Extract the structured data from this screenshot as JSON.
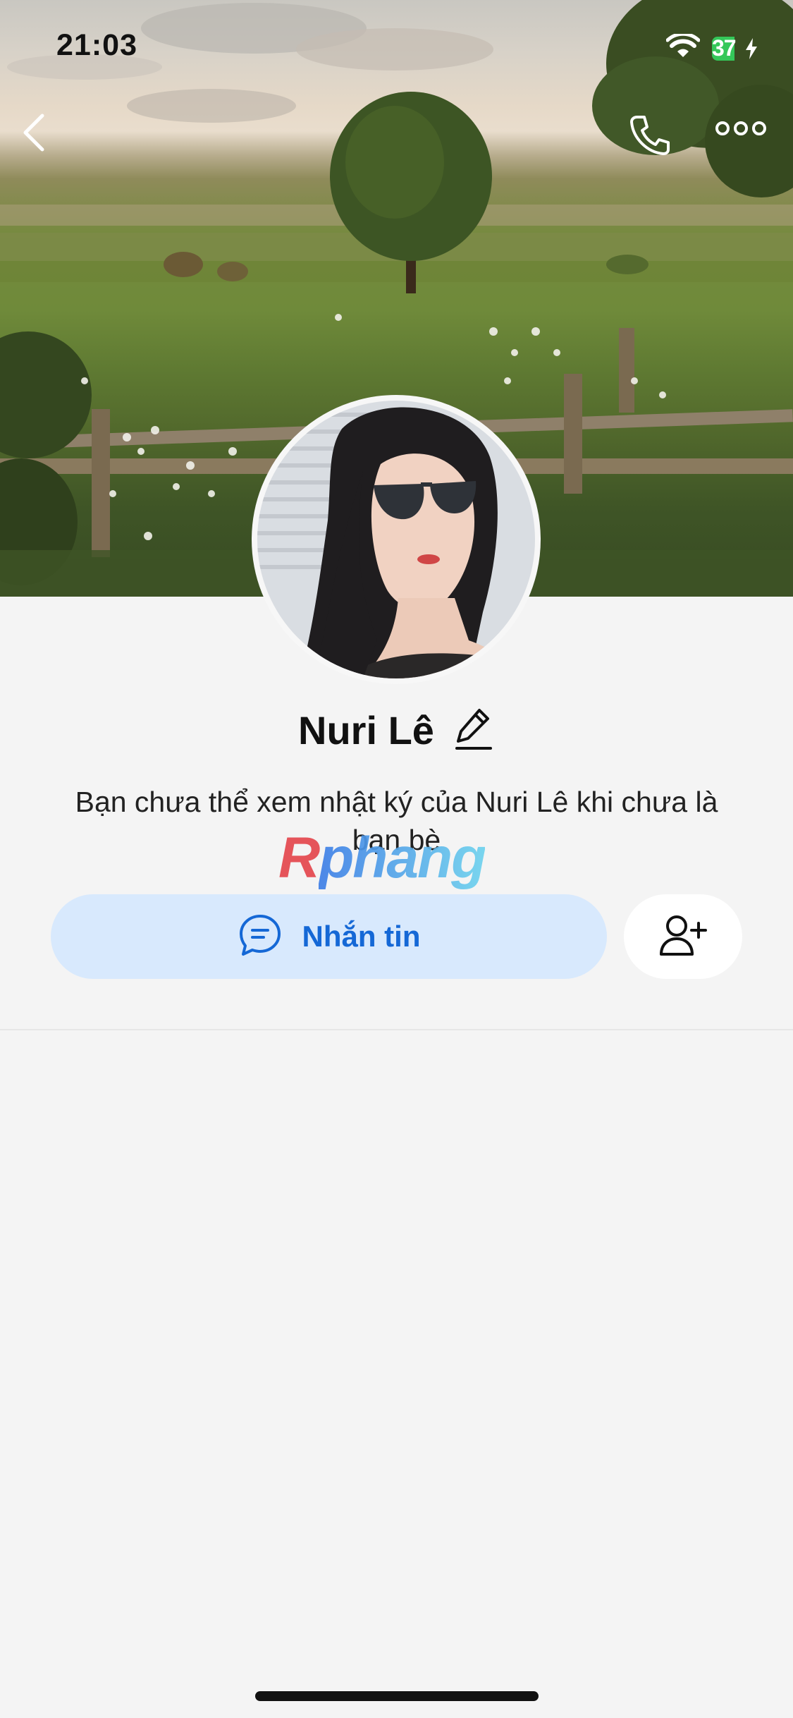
{
  "status_bar": {
    "time": "21:03",
    "battery": "37",
    "wifi_icon": "wifi-icon",
    "battery_icon": "battery-charging-icon"
  },
  "nav": {
    "back_icon": "chevron-left-icon",
    "call_icon": "phone-icon",
    "more_icon": "more-horizontal-icon"
  },
  "profile": {
    "name": "Nuri Lê",
    "edit_icon": "pencil-icon",
    "notice": "Bạn chưa thể xem nhật ký của Nuri Lê khi chưa là bạn bè"
  },
  "actions": {
    "message_label": "Nhắn tin",
    "message_icon": "chat-bubble-icon",
    "add_friend_icon": "add-friend-icon"
  },
  "watermark": {
    "first": "R",
    "rest": "phang"
  },
  "colors": {
    "accent": "#1568d6",
    "message_button_bg": "#d8e9fd",
    "background": "#f4f4f4",
    "battery_green": "#34c759"
  }
}
